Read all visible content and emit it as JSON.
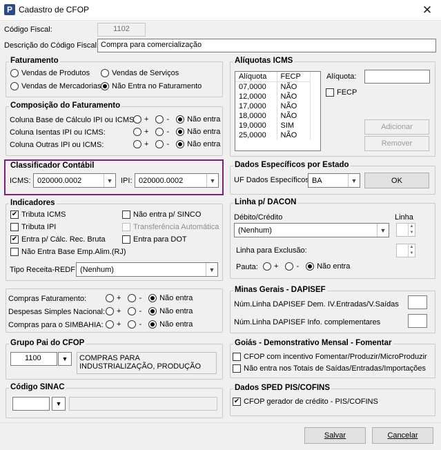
{
  "window": {
    "title": "Cadastro de CFOP",
    "close": "✕",
    "icon": "P"
  },
  "codigo": {
    "label": "Código Fiscal:",
    "value": "1102"
  },
  "descricao": {
    "label": "Descrição do Código Fiscal:",
    "value": "Compra para comercialização"
  },
  "faturamento": {
    "title": "Faturamento",
    "opt1": "Vendas de Produtos",
    "opt2": "Vendas de Serviços",
    "opt3": "Vendas de Mercadorias",
    "opt4": "Não Entra no Faturamento"
  },
  "composicao": {
    "title": "Composição do Faturamento",
    "row1": "Coluna Base de Cálculo IPI ou ICMS:",
    "row2": "Coluna Isentas IPI ou ICMS:",
    "row3": "Coluna Outras IPI ou ICMS:",
    "plus": "+",
    "minus": "-",
    "none": "Não entra"
  },
  "classificador": {
    "title": "Classificador Contábil",
    "icms_label": "ICMS:",
    "icms_value": "020000.0002",
    "ipi_label": "IPI:",
    "ipi_value": "020000.0002"
  },
  "indicadores": {
    "title": "Indicadores",
    "c1": "Tributa ICMS",
    "c2": "Tributa IPI",
    "c3": "Entra p/ Cálc. Rec. Bruta",
    "c4": "Não Entra Base Emp.Alim.(RJ)",
    "c5": "Não entra p/ SINCO",
    "c6": "Transferência Automática",
    "c7": "Entra para DOT",
    "tipo_label": "Tipo Receita-REDF:",
    "tipo_value": "(Nenhum)"
  },
  "extras": {
    "r1": "Compras Faturamento:",
    "r2": "Despesas Simples Nacional:",
    "r3": "Compras para o SIMBAHIA:",
    "plus": "+",
    "minus": "-",
    "none": "Não entra"
  },
  "grupo": {
    "title": "Grupo Pai do CFOP",
    "code": "1100",
    "desc": "COMPRAS PARA INDUSTRIALIZAÇÃO, PRODUÇÃO"
  },
  "sinac": {
    "title": "Código SINAC"
  },
  "aliquotas": {
    "title": "Alíquotas ICMS",
    "col1": "Alíquota",
    "col2": "FECP",
    "rows": [
      [
        "07,0000",
        "NÃO"
      ],
      [
        "12,0000",
        "NÃO"
      ],
      [
        "17,0000",
        "NÃO"
      ],
      [
        "18,0000",
        "NÃO"
      ],
      [
        "19,0000",
        "SIM"
      ],
      [
        "25,0000",
        "NÃO"
      ]
    ],
    "aliq_label": "Alíquota:",
    "fecp": "FECP",
    "adicionar": "Adicionar",
    "remover": "Remover"
  },
  "estado": {
    "title": "Dados Específicos por Estado",
    "uf_label": "UF Dados Específicos:",
    "uf_value": "BA",
    "ok": "OK"
  },
  "dacon": {
    "title": "Linha p/ DACON",
    "debito": "Débito/Crédito",
    "linha": "Linha",
    "combo": "(Nenhum)",
    "exclusao": "Linha para Exclusão:",
    "pauta": "Pauta:",
    "plus": "+",
    "minus": "-",
    "none": "Não entra"
  },
  "minas": {
    "title": "Minas Gerais - DAPISEF",
    "l1": "Núm.Linha DAPISEF Dem. IV.Entradas/V.Saídas",
    "l2": "Núm.Linha DAPISEF Info. complementares"
  },
  "goias": {
    "title": "Goiás - Demonstrativo Mensal - Fomentar",
    "c1": "CFOP com incentivo  Fomentar/Produzir/MicroProduzir",
    "c2": "Não entra nos Totais de  Saídas/Entradas/Importações"
  },
  "sped": {
    "title": "Dados SPED PIS/COFINS",
    "c1": "CFOP gerador de crédito - PIS/COFINS"
  },
  "footer": {
    "salvar": "Salvar",
    "cancelar": "Cancelar"
  },
  "colors": {
    "highlight": "#7b1f7b"
  }
}
